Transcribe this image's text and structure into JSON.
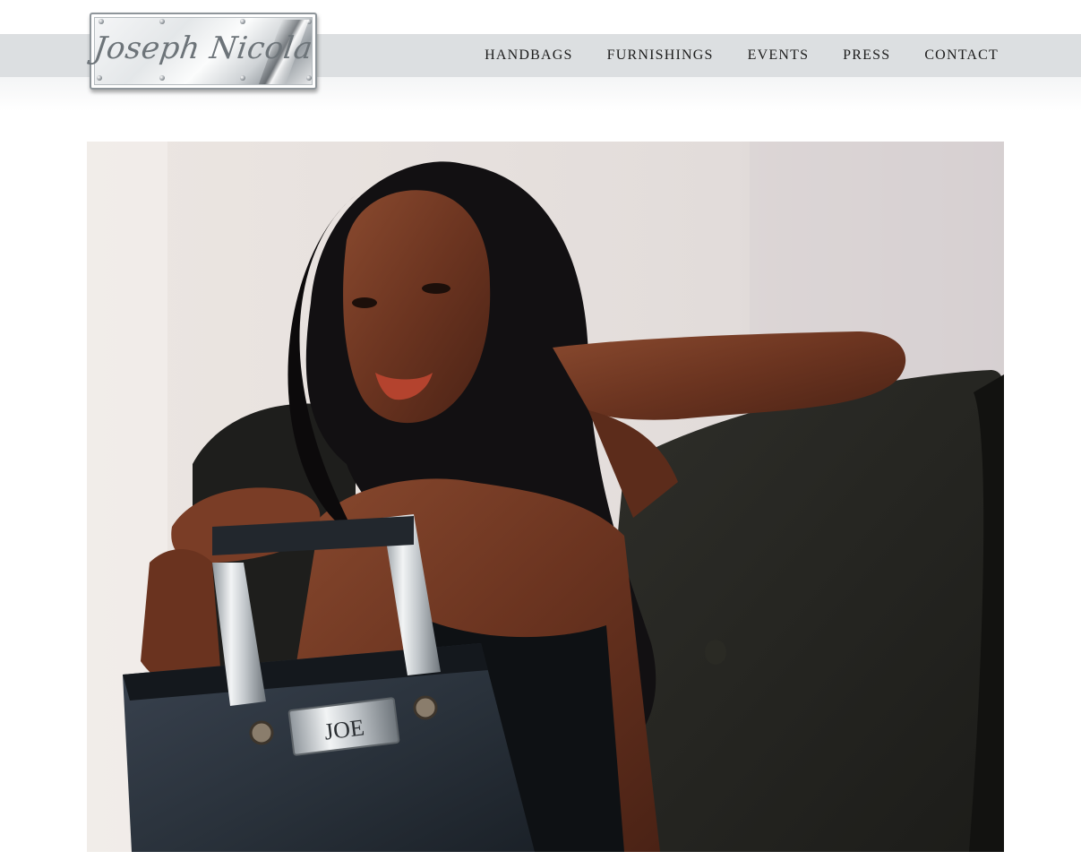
{
  "brand": {
    "logo_text": "Joseph Nicola"
  },
  "nav": {
    "items": [
      {
        "label": "HANDBAGS"
      },
      {
        "label": "FURNISHINGS"
      },
      {
        "label": "EVENTS"
      },
      {
        "label": "PRESS"
      },
      {
        "label": "CONTACT"
      }
    ]
  },
  "hero": {
    "bag_plate_text": "JOE"
  },
  "colors": {
    "nav_band": "#dcdfe1",
    "nav_text": "#1c1c1c",
    "background": "#ffffff"
  }
}
